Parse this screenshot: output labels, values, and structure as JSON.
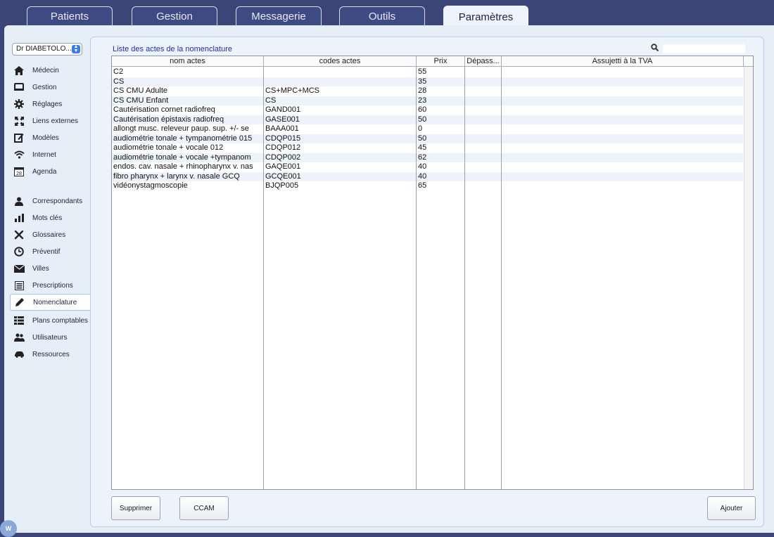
{
  "tabs": [
    {
      "label": "Patients"
    },
    {
      "label": "Gestion"
    },
    {
      "label": "Messagerie"
    },
    {
      "label": "Outils"
    },
    {
      "label": "Paramètres"
    }
  ],
  "doctor_select": {
    "value": "Dr DIABETOLO..."
  },
  "nav_group1": [
    {
      "label": "Médecin",
      "icon": "house-icon"
    },
    {
      "label": "Gestion",
      "icon": "monitor-icon"
    },
    {
      "label": "Réglages",
      "icon": "gear-icon"
    },
    {
      "label": "Liens externes",
      "icon": "expand-arrows-icon"
    },
    {
      "label": "Modèles",
      "icon": "edit-square-icon"
    },
    {
      "label": "Internet",
      "icon": "wifi-icon"
    },
    {
      "label": "Agenda",
      "icon": "calendar-icon"
    }
  ],
  "nav_group2": [
    {
      "label": "Correspondants",
      "icon": "person-icon"
    },
    {
      "label": "Mots clés",
      "icon": "bar-chart-icon"
    },
    {
      "label": "Glossaires",
      "icon": "tools-icon"
    },
    {
      "label": "Préventif",
      "icon": "clock-icon"
    },
    {
      "label": "Villes",
      "icon": "envelope-icon"
    },
    {
      "label": "Prescriptions",
      "icon": "list-box-icon"
    },
    {
      "label": "Nomenclature",
      "icon": "pencil-icon"
    },
    {
      "label": "Plans comptables",
      "icon": "list-icon"
    },
    {
      "label": "Utilisateurs",
      "icon": "users-icon"
    },
    {
      "label": "Ressources",
      "icon": "car-icon"
    }
  ],
  "calendar_day": "28",
  "list_title": "Liste des actes de la nomenclature",
  "table": {
    "headers": [
      "nom actes",
      "codes actes",
      "Prix",
      "Dépass...",
      "Assujetti à la TVA"
    ],
    "rows": [
      [
        "C2",
        "",
        "55",
        "",
        ""
      ],
      [
        "CS",
        "",
        "35",
        "",
        ""
      ],
      [
        "CS CMU Adulte",
        "CS+MPC+MCS",
        "28",
        "",
        ""
      ],
      [
        "CS CMU Enfant",
        "CS",
        "23",
        "",
        ""
      ],
      [
        "Cautérisation cornet radiofreq",
        "GAND001",
        "60",
        "",
        ""
      ],
      [
        "Cautérisation épistaxis radiofreq",
        "GASE001",
        "50",
        "",
        ""
      ],
      [
        "allongt musc. releveur paup. sup. +/- se",
        "BAAA001",
        "0",
        "",
        ""
      ],
      [
        "audiométrie tonale + tympanométrie 015",
        "CDQP015",
        "50",
        "",
        ""
      ],
      [
        "audiométrie tonale + vocale  012",
        "CDQP012",
        "45",
        "",
        ""
      ],
      [
        "audiométrie tonale + vocale +tympanom",
        "CDQP002",
        "62",
        "",
        ""
      ],
      [
        "endos. cav. nasale + rhinopharynx v. nas",
        "GAQE001",
        "40",
        "",
        ""
      ],
      [
        "fibro pharynx + larynx v. nasale GCQ",
        "GCQE001",
        "40",
        "",
        ""
      ],
      [
        "vidéonystagmoscopie",
        "BJQP005",
        "65",
        "",
        ""
      ]
    ]
  },
  "buttons": {
    "delete": "Supprimer",
    "ccam": "CCAM",
    "add": "Ajouter"
  },
  "corner_logo": "W"
}
